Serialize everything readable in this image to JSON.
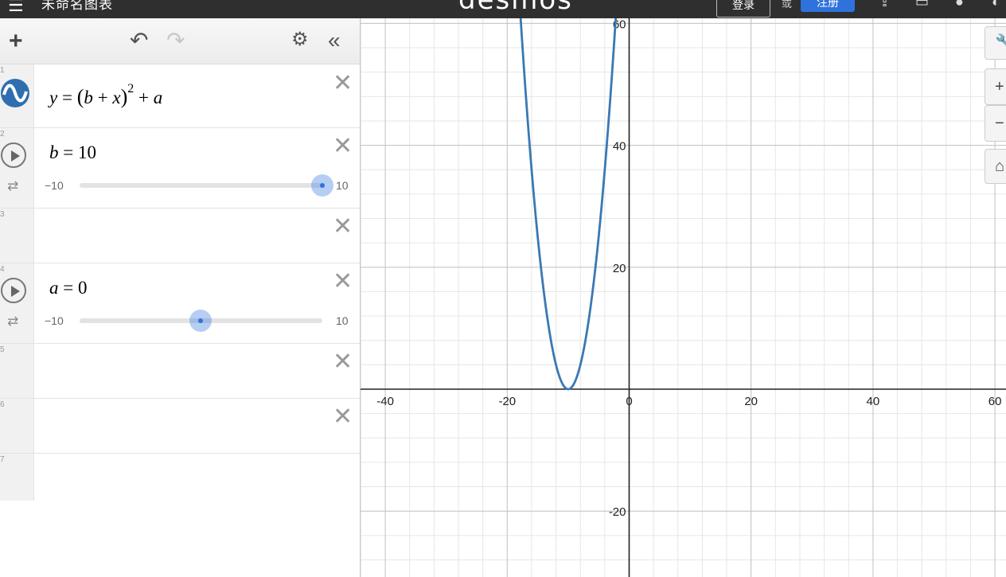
{
  "topbar": {
    "menu_icon": "hamburger-icon",
    "title": "未命名图表",
    "logo": "desmos",
    "login": "登录",
    "or": "或",
    "signup": "注册"
  },
  "toolbar": {
    "add": "+",
    "undo": "↶",
    "redo": "↷",
    "settings": "⚙",
    "collapse": "«"
  },
  "expressions": [
    {
      "index": "1",
      "latex": "y = (b + x)^2 + a"
    },
    {
      "index": "2",
      "name": "b",
      "value": "10",
      "min": "−10",
      "max": "10",
      "fraction": 1.0
    },
    {
      "index": "3"
    },
    {
      "index": "4",
      "name": "a",
      "value": "0",
      "min": "−10",
      "max": "10",
      "fraction": 0.5
    },
    {
      "index": "5"
    },
    {
      "index": "6"
    },
    {
      "index": "7"
    }
  ],
  "graph": {
    "x_ticks": [
      "-40",
      "-20",
      "0",
      "20",
      "40",
      "60"
    ],
    "y_ticks": [
      "60",
      "40",
      "20",
      "-20"
    ],
    "curve_color": "#3a78b4",
    "curve": {
      "a": 0,
      "b": 10
    }
  },
  "side_buttons": [
    "wrench-icon",
    "zoom-in-icon",
    "zoom-out-icon",
    "home-icon"
  ]
}
